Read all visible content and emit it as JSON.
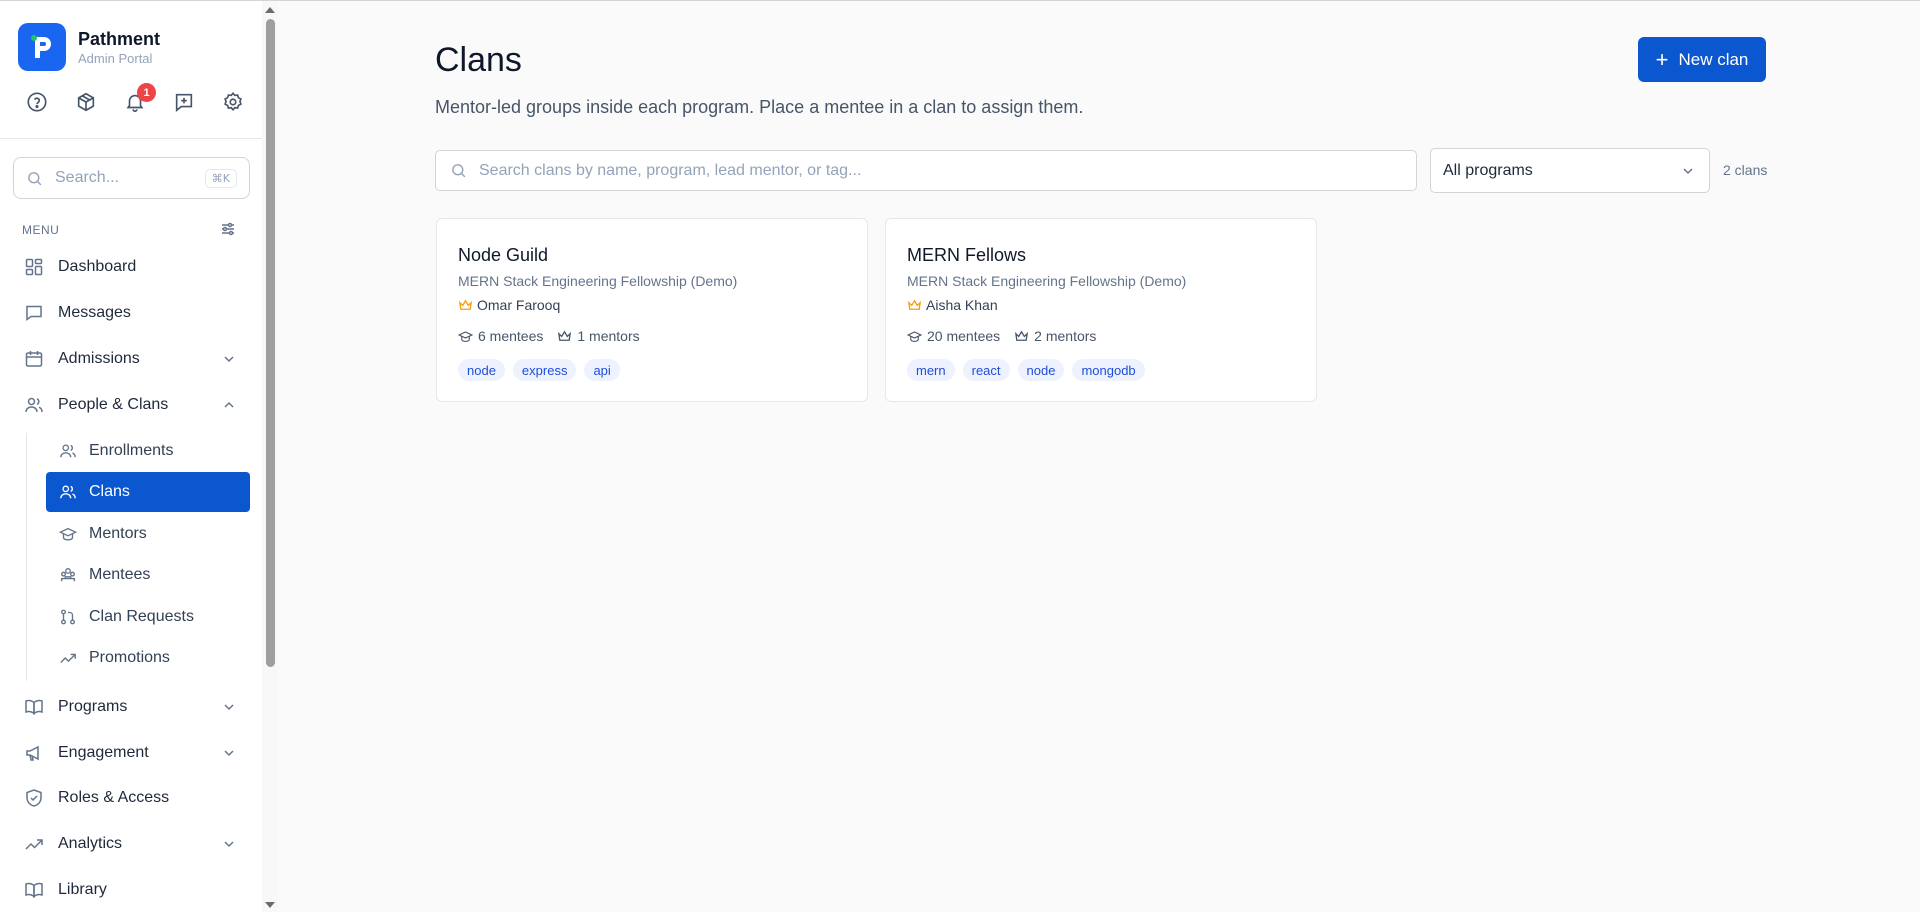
{
  "brand": {
    "name": "Pathment",
    "subtitle": "Admin Portal"
  },
  "notifications": {
    "count": "1"
  },
  "sidebar_search": {
    "placeholder": "Search...",
    "shortcut": "⌘K"
  },
  "menu_label": "MENU",
  "nav": [
    {
      "label": "Dashboard",
      "icon": "grid-icon"
    },
    {
      "label": "Messages",
      "icon": "message-icon"
    },
    {
      "label": "Admissions",
      "icon": "calendar-icon",
      "expandable": true
    },
    {
      "label": "People & Clans",
      "icon": "users-icon",
      "expanded": true
    },
    {
      "label": "Programs",
      "icon": "book-icon",
      "expandable": true
    },
    {
      "label": "Engagement",
      "icon": "megaphone-icon",
      "expandable": true
    },
    {
      "label": "Roles & Access",
      "icon": "shield-icon"
    },
    {
      "label": "Analytics",
      "icon": "trend-icon",
      "expandable": true
    },
    {
      "label": "Library",
      "icon": "book-open-icon"
    }
  ],
  "subnav": [
    {
      "label": "Enrollments",
      "icon": "users-icon"
    },
    {
      "label": "Clans",
      "icon": "users-icon",
      "active": true
    },
    {
      "label": "Mentors",
      "icon": "graduation-cap-icon"
    },
    {
      "label": "Mentees",
      "icon": "people-group-icon"
    },
    {
      "label": "Clan Requests",
      "icon": "git-pull-request-icon"
    },
    {
      "label": "Promotions",
      "icon": "trend-icon"
    }
  ],
  "page": {
    "title": "Clans",
    "description": "Mentor-led groups inside each program. Place a mentee in a clan to assign them.",
    "new_button": "New clan",
    "search_placeholder": "Search clans by name, program, lead mentor, or tag...",
    "filter_selected": "All programs",
    "count_label": "2 clans"
  },
  "clans": [
    {
      "name": "Node Guild",
      "program": "MERN Stack Engineering Fellowship (Demo)",
      "lead": "Omar Farooq",
      "mentees": "6 mentees",
      "mentors": "1 mentors",
      "tags": [
        "node",
        "express",
        "api"
      ]
    },
    {
      "name": "MERN Fellows",
      "program": "MERN Stack Engineering Fellowship (Demo)",
      "lead": "Aisha Khan",
      "mentees": "20 mentees",
      "mentors": "2 mentors",
      "tags": [
        "mern",
        "react",
        "node",
        "mongodb"
      ]
    }
  ],
  "colors": {
    "accent": "#0b57d0",
    "brand": "#1a66f0",
    "crown": "#f59e0b",
    "badge": "#ef4444"
  }
}
